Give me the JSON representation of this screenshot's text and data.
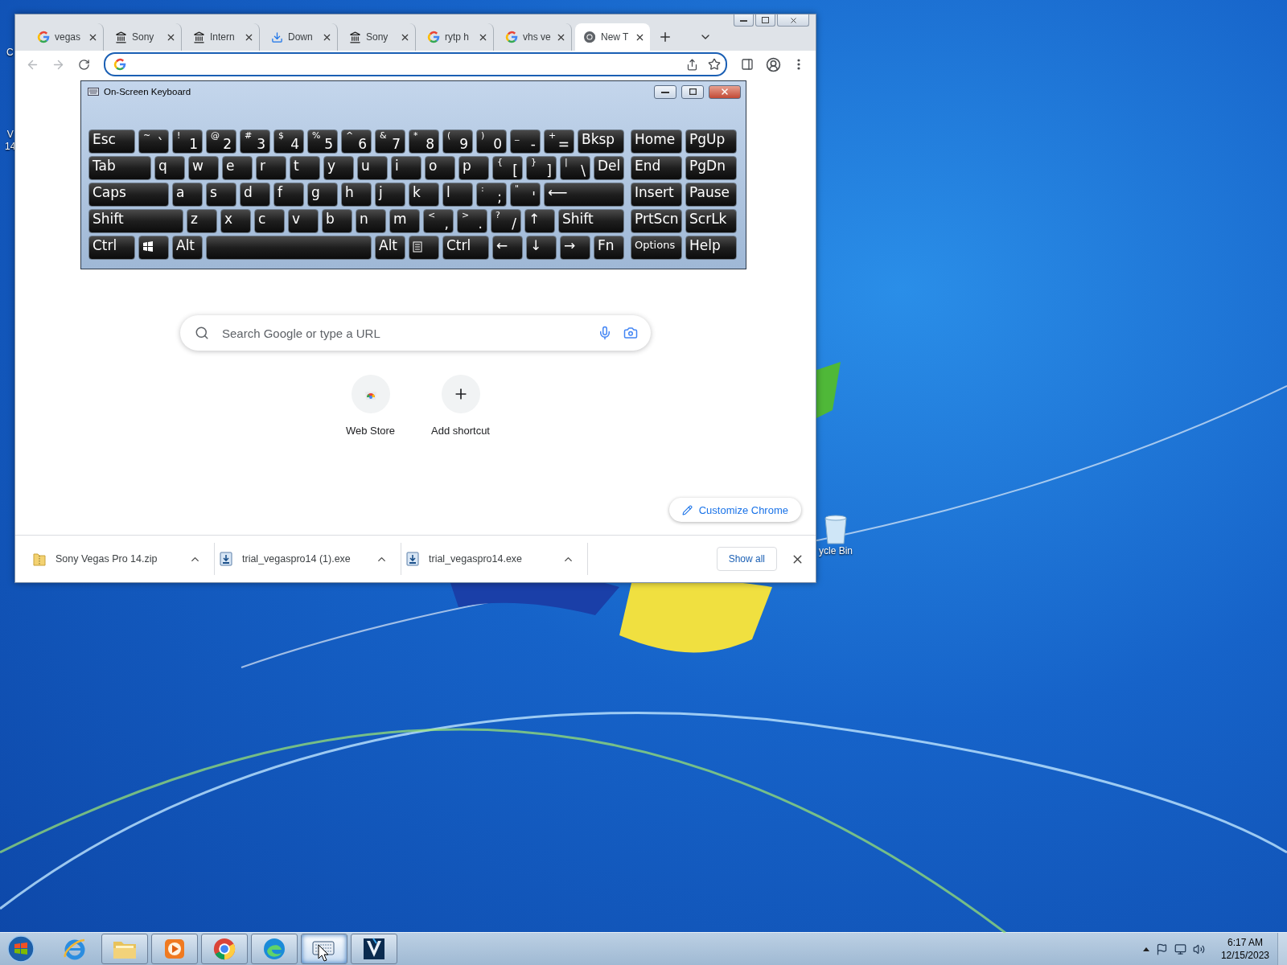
{
  "desktop": {
    "icons": [
      {
        "lines": [
          "C"
        ]
      },
      {
        "lines": [
          "V",
          "14"
        ]
      }
    ],
    "recycle_bin": {
      "label": "ycle Bin"
    }
  },
  "browser": {
    "tabs": [
      {
        "title": "vegas",
        "kind": "search",
        "selected": false
      },
      {
        "title": "Sony",
        "kind": "archive",
        "selected": false
      },
      {
        "title": "Intern",
        "kind": "archive",
        "selected": false
      },
      {
        "title": "Down",
        "kind": "download",
        "selected": false
      },
      {
        "title": "Sony",
        "kind": "archive",
        "selected": false
      },
      {
        "title": "rytp h",
        "kind": "search",
        "selected": false
      },
      {
        "title": "vhs ve",
        "kind": "search",
        "selected": false
      },
      {
        "title": "New T",
        "kind": "newtab",
        "selected": true
      }
    ],
    "back": {
      "disabled": true
    },
    "forward": {
      "disabled": true
    },
    "new_tab_page": {
      "search": {
        "placeholder": "Search Google or type a URL"
      },
      "shortcuts": [
        {
          "label": "Web Store",
          "kind": "store"
        },
        {
          "label": "Add shortcut",
          "kind": "add"
        }
      ],
      "customize": "Customize Chrome"
    },
    "downloads": {
      "items": [
        {
          "name": "Sony Vegas Pro 14.zip",
          "kind": "zip"
        },
        {
          "name": "trial_vegaspro14 (1).exe",
          "kind": "exe"
        },
        {
          "name": "trial_vegaspro14.exe",
          "kind": "exe"
        }
      ],
      "show_all": "Show all"
    }
  },
  "keyboard": {
    "title": "On-Screen Keyboard",
    "rows": [
      {
        "keys": [
          {
            "label": "Esc",
            "kind": "wide"
          },
          {
            "label": "`",
            "shift": "~",
            "kind": "std"
          },
          {
            "label": "1",
            "shift": "!",
            "kind": "std"
          },
          {
            "label": "2",
            "shift": "@",
            "kind": "std"
          },
          {
            "label": "3",
            "shift": "#",
            "kind": "std"
          },
          {
            "label": "4",
            "shift": "$",
            "kind": "std"
          },
          {
            "label": "5",
            "shift": "%",
            "kind": "std"
          },
          {
            "label": "6",
            "shift": "^",
            "kind": "std"
          },
          {
            "label": "7",
            "shift": "&",
            "kind": "std"
          },
          {
            "label": "8",
            "shift": "*",
            "kind": "std"
          },
          {
            "label": "9",
            "shift": "(",
            "kind": "std"
          },
          {
            "label": "0",
            "shift": ")",
            "kind": "std"
          },
          {
            "label": "-",
            "shift": "_",
            "kind": "std"
          },
          {
            "label": "=",
            "shift": "+",
            "kind": "std"
          },
          {
            "label": "Bksp",
            "kind": "wide"
          }
        ]
      },
      {
        "keys": [
          {
            "label": "Tab",
            "kind": "tab"
          },
          {
            "label": "q",
            "kind": "std"
          },
          {
            "label": "w",
            "kind": "std"
          },
          {
            "label": "e",
            "kind": "std"
          },
          {
            "label": "r",
            "kind": "std"
          },
          {
            "label": "t",
            "kind": "std"
          },
          {
            "label": "y",
            "kind": "std"
          },
          {
            "label": "u",
            "kind": "std"
          },
          {
            "label": "i",
            "kind": "std"
          },
          {
            "label": "o",
            "kind": "std"
          },
          {
            "label": "p",
            "kind": "std"
          },
          {
            "label": "[",
            "shift": "{",
            "kind": "std"
          },
          {
            "label": "]",
            "shift": "}",
            "kind": "std"
          },
          {
            "label": "\\",
            "shift": "|",
            "kind": "std"
          },
          {
            "label": "Del",
            "kind": "std"
          }
        ]
      },
      {
        "keys": [
          {
            "label": "Caps",
            "kind": "caps"
          },
          {
            "label": "a",
            "kind": "std"
          },
          {
            "label": "s",
            "kind": "std"
          },
          {
            "label": "d",
            "kind": "std"
          },
          {
            "label": "f",
            "kind": "std"
          },
          {
            "label": "g",
            "kind": "std"
          },
          {
            "label": "h",
            "kind": "std"
          },
          {
            "label": "j",
            "kind": "std"
          },
          {
            "label": "k",
            "kind": "std"
          },
          {
            "label": "l",
            "kind": "std"
          },
          {
            "label": ";",
            "shift": ":",
            "kind": "std"
          },
          {
            "label": "'",
            "shift": "\"",
            "kind": "std"
          },
          {
            "label": "⟵",
            "kind": "enter"
          }
        ]
      },
      {
        "keys": [
          {
            "label": "Shift",
            "kind": "lshift"
          },
          {
            "label": "z",
            "kind": "std"
          },
          {
            "label": "x",
            "kind": "std"
          },
          {
            "label": "c",
            "kind": "std"
          },
          {
            "label": "v",
            "kind": "std"
          },
          {
            "label": "b",
            "kind": "std"
          },
          {
            "label": "n",
            "kind": "std"
          },
          {
            "label": "m",
            "kind": "std"
          },
          {
            "label": ",",
            "shift": "<",
            "kind": "std"
          },
          {
            "label": ".",
            "shift": ">",
            "kind": "std"
          },
          {
            "label": "/",
            "shift": "?",
            "kind": "std"
          },
          {
            "label": "↑",
            "kind": "std"
          },
          {
            "label": "Shift",
            "kind": "rshift"
          }
        ]
      },
      {
        "keys": [
          {
            "label": "Ctrl",
            "kind": "wide"
          },
          {
            "kind": "win"
          },
          {
            "label": "Alt",
            "kind": "std"
          },
          {
            "kind": "space"
          },
          {
            "label": "Alt",
            "kind": "std"
          },
          {
            "kind": "menu"
          },
          {
            "label": "Ctrl",
            "kind": "wide"
          },
          {
            "label": "←",
            "kind": "std"
          },
          {
            "label": "↓",
            "kind": "std"
          },
          {
            "label": "→",
            "kind": "std"
          },
          {
            "label": "Fn",
            "kind": "std"
          }
        ]
      }
    ],
    "nav_rows": [
      {
        "keys": [
          {
            "label": "Home",
            "kind": "nav"
          },
          {
            "label": "PgUp",
            "kind": "nav"
          }
        ]
      },
      {
        "keys": [
          {
            "label": "End",
            "kind": "nav"
          },
          {
            "label": "PgDn",
            "kind": "nav"
          }
        ]
      },
      {
        "keys": [
          {
            "label": "Insert",
            "kind": "nav"
          },
          {
            "label": "Pause",
            "kind": "nav"
          }
        ]
      },
      {
        "keys": [
          {
            "label": "PrtScn",
            "kind": "nav"
          },
          {
            "label": "ScrLk",
            "kind": "nav"
          }
        ]
      },
      {
        "keys": [
          {
            "label": "Options",
            "kind": "nav"
          },
          {
            "label": "Help",
            "kind": "nav"
          }
        ]
      }
    ]
  },
  "taskbar": {
    "apps": [
      {
        "kind": "ie",
        "running": false,
        "selected": false
      },
      {
        "kind": "folder",
        "running": true,
        "selected": false
      },
      {
        "kind": "media",
        "running": true,
        "selected": false
      },
      {
        "kind": "chrome",
        "running": true,
        "selected": false
      },
      {
        "kind": "edge",
        "running": true,
        "selected": false
      },
      {
        "kind": "keyboard",
        "running": true,
        "selected": true
      },
      {
        "kind": "vegas",
        "running": true,
        "selected": false
      }
    ],
    "time": "6:17 AM",
    "date": "12/15/2023"
  }
}
